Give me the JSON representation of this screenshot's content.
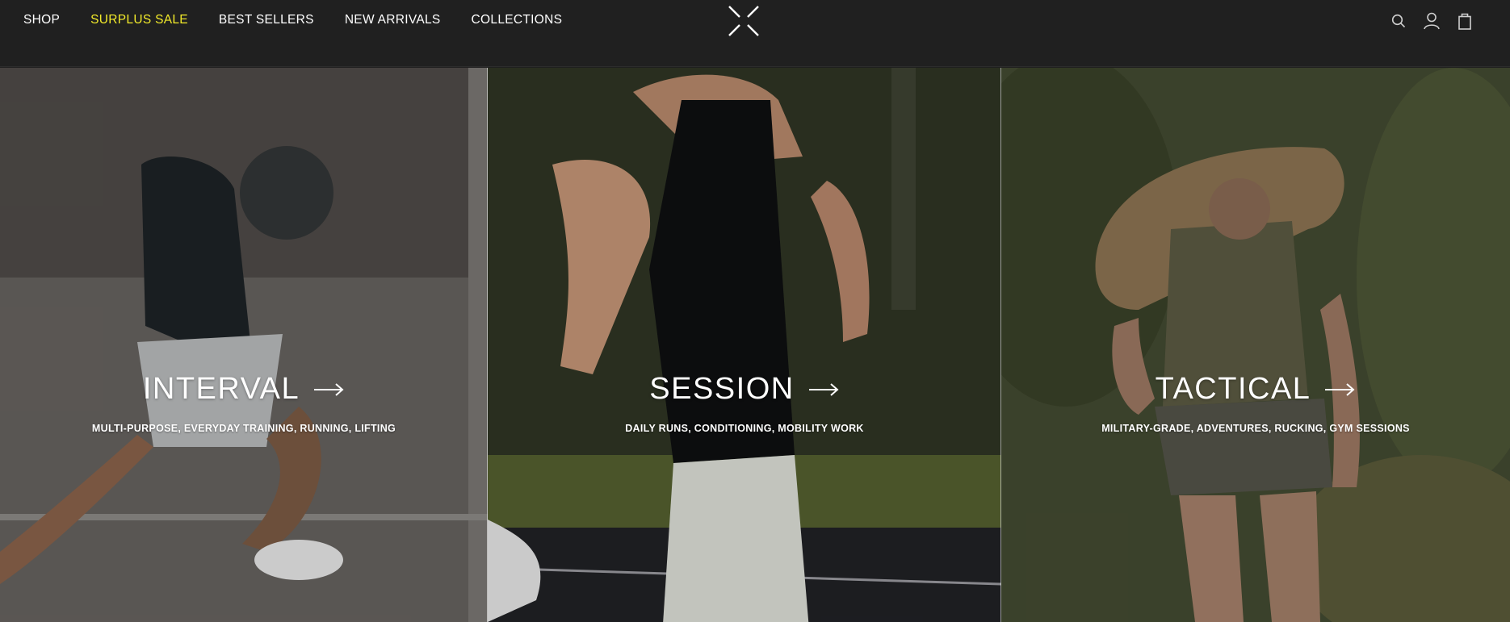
{
  "nav": {
    "items": [
      {
        "label": "SHOP",
        "highlight": false
      },
      {
        "label": "SURPLUS SALE",
        "highlight": true
      },
      {
        "label": "BEST SELLERS",
        "highlight": false
      },
      {
        "label": "NEW ARRIVALS",
        "highlight": false
      },
      {
        "label": "COLLECTIONS",
        "highlight": false
      }
    ],
    "highlight_color": "#f2ea2a"
  },
  "header": {
    "logo_icon": "x-burst-logo-icon",
    "right_icons": [
      "search-icon",
      "account-icon",
      "cart-icon"
    ]
  },
  "panels": [
    {
      "title": "INTERVAL",
      "subtitle": "MULTI-PURPOSE, EVERYDAY TRAINING, RUNNING, LIFTING",
      "arrow_icon": "arrow-right-icon"
    },
    {
      "title": "SESSION",
      "subtitle": "DAILY RUNS, CONDITIONING, MOBILITY WORK",
      "arrow_icon": "arrow-right-icon"
    },
    {
      "title": "TACTICAL",
      "subtitle": "MILITARY-GRADE, ADVENTURES, RUCKING, GYM SESSIONS",
      "arrow_icon": "arrow-right-icon"
    }
  ],
  "colors": {
    "header_bg": "#202020",
    "text": "#ffffff"
  }
}
